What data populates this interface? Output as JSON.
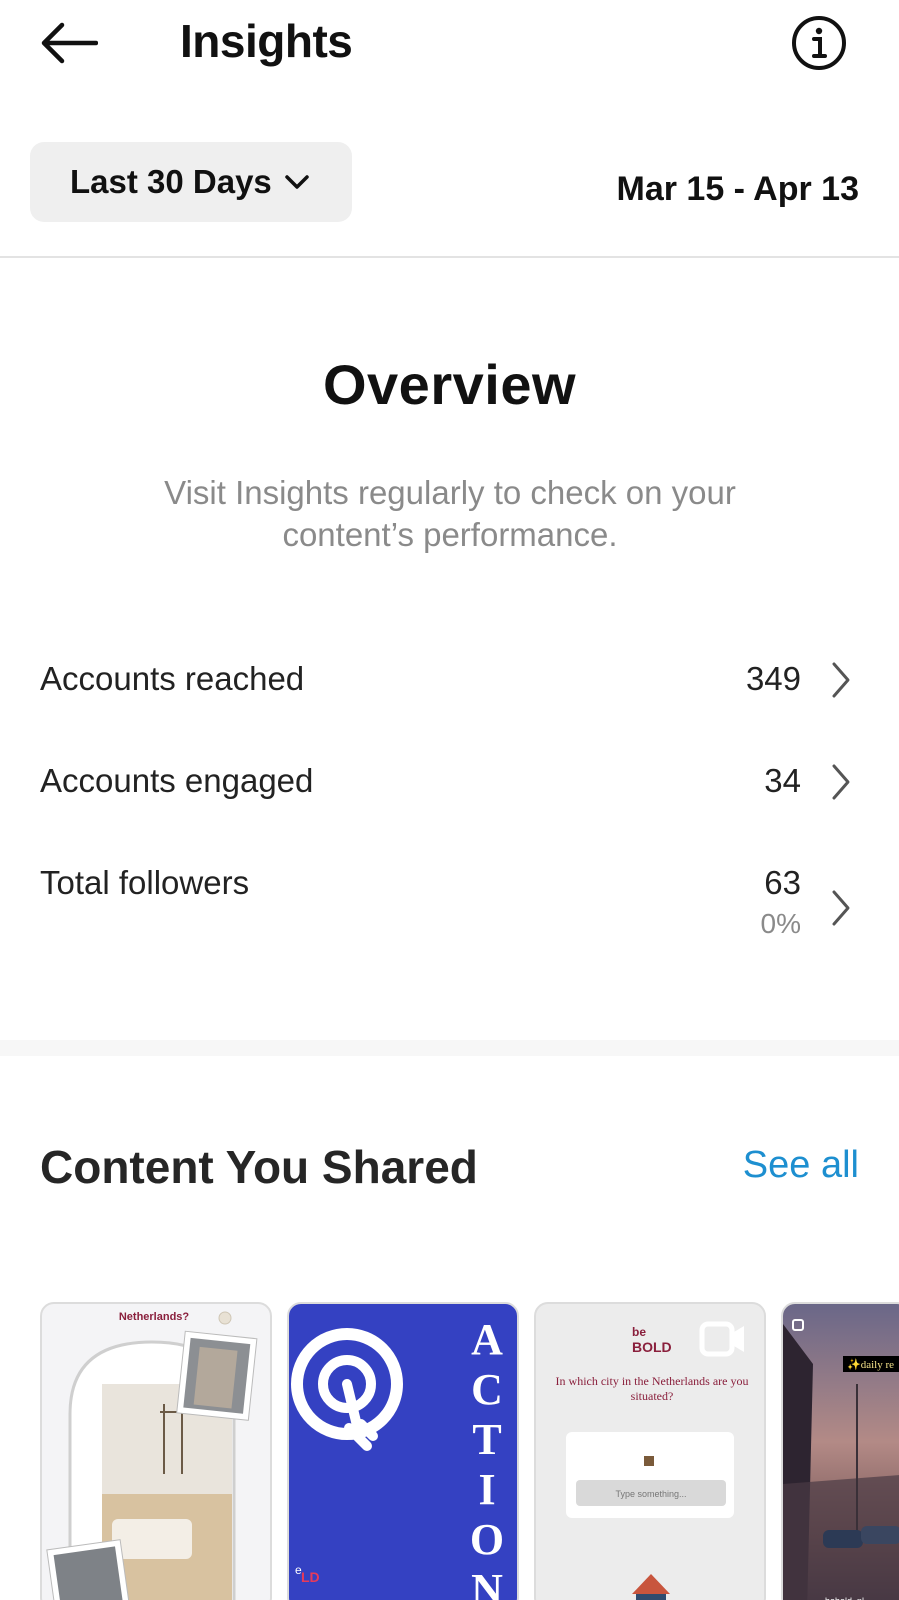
{
  "header": {
    "title": "Insights"
  },
  "filter": {
    "range_label": "Last 30 Days",
    "date_range": "Mar 15 - Apr 13"
  },
  "overview": {
    "title": "Overview",
    "subtitle": "Visit Insights regularly to check on your content’s performance.",
    "stats": [
      {
        "label": "Accounts reached",
        "value": "349"
      },
      {
        "label": "Accounts engaged",
        "value": "34"
      },
      {
        "label": "Total followers",
        "value": "63",
        "change": "0%"
      }
    ]
  },
  "content": {
    "title": "Content You Shared",
    "see_all": "See all",
    "thumbnails": [
      {
        "caption": "Netherlands?"
      },
      {
        "caption": "ACTION",
        "logo": "LD"
      },
      {
        "brand_top": "be",
        "brand": "BOLD",
        "question": "In which city in the Netherlands are you situated?",
        "input_placeholder": "Type something..."
      },
      {
        "overlay": "✨daily re",
        "handle": "bebold_nl"
      }
    ]
  },
  "colors": {
    "accent": "#1d8fd0",
    "action_blue": "#3441c2",
    "brand_maroon": "#8a1f3c"
  }
}
